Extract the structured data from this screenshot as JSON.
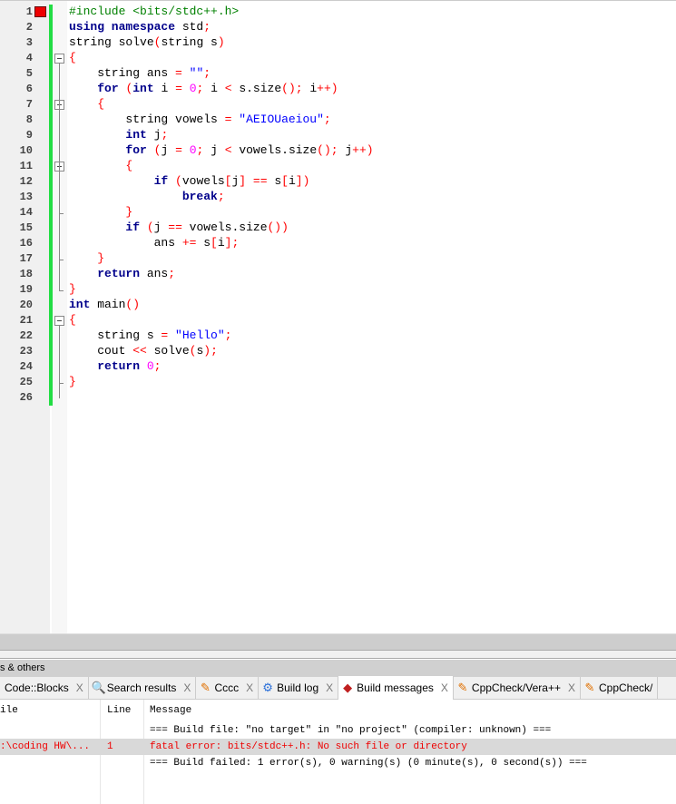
{
  "editor": {
    "lines": [
      [
        [
          "pp",
          "#include <bits/stdc++.h>"
        ]
      ],
      [
        [
          "kw",
          "using namespace"
        ],
        [
          "pl",
          " std"
        ],
        [
          "op",
          ";"
        ]
      ],
      [
        [
          "pl",
          "string solve"
        ],
        [
          "op",
          "("
        ],
        [
          "pl",
          "string s"
        ],
        [
          "op",
          ")"
        ]
      ],
      [
        [
          "op",
          "{"
        ]
      ],
      [
        [
          "pl",
          "    string ans "
        ],
        [
          "op",
          "="
        ],
        [
          "pl",
          " "
        ],
        [
          "str",
          "\"\""
        ],
        [
          "op",
          ";"
        ]
      ],
      [
        [
          "pl",
          "    "
        ],
        [
          "kw",
          "for"
        ],
        [
          "pl",
          " "
        ],
        [
          "op",
          "("
        ],
        [
          "kw",
          "int"
        ],
        [
          "pl",
          " i "
        ],
        [
          "op",
          "="
        ],
        [
          "pl",
          " "
        ],
        [
          "num",
          "0"
        ],
        [
          "op",
          ";"
        ],
        [
          "pl",
          " i "
        ],
        [
          "op",
          "<"
        ],
        [
          "pl",
          " s.size"
        ],
        [
          "op",
          "();"
        ],
        [
          "pl",
          " i"
        ],
        [
          "op",
          "++)"
        ]
      ],
      [
        [
          "pl",
          "    "
        ],
        [
          "op",
          "{"
        ]
      ],
      [
        [
          "pl",
          "        string vowels "
        ],
        [
          "op",
          "="
        ],
        [
          "pl",
          " "
        ],
        [
          "str",
          "\"AEIOUaeiou\""
        ],
        [
          "op",
          ";"
        ]
      ],
      [
        [
          "pl",
          "        "
        ],
        [
          "kw",
          "int"
        ],
        [
          "pl",
          " j"
        ],
        [
          "op",
          ";"
        ]
      ],
      [
        [
          "pl",
          "        "
        ],
        [
          "kw",
          "for"
        ],
        [
          "pl",
          " "
        ],
        [
          "op",
          "("
        ],
        [
          "pl",
          "j "
        ],
        [
          "op",
          "="
        ],
        [
          "pl",
          " "
        ],
        [
          "num",
          "0"
        ],
        [
          "op",
          ";"
        ],
        [
          "pl",
          " j "
        ],
        [
          "op",
          "<"
        ],
        [
          "pl",
          " vowels.size"
        ],
        [
          "op",
          "();"
        ],
        [
          "pl",
          " j"
        ],
        [
          "op",
          "++)"
        ]
      ],
      [
        [
          "pl",
          "        "
        ],
        [
          "op",
          "{"
        ]
      ],
      [
        [
          "pl",
          "            "
        ],
        [
          "kw",
          "if"
        ],
        [
          "pl",
          " "
        ],
        [
          "op",
          "("
        ],
        [
          "pl",
          "vowels"
        ],
        [
          "op",
          "["
        ],
        [
          "pl",
          "j"
        ],
        [
          "op",
          "]"
        ],
        [
          "pl",
          " "
        ],
        [
          "op",
          "=="
        ],
        [
          "pl",
          " s"
        ],
        [
          "op",
          "["
        ],
        [
          "pl",
          "i"
        ],
        [
          "op",
          "])"
        ]
      ],
      [
        [
          "pl",
          "                "
        ],
        [
          "kw",
          "break"
        ],
        [
          "op",
          ";"
        ]
      ],
      [
        [
          "pl",
          "        "
        ],
        [
          "op",
          "}"
        ]
      ],
      [
        [
          "pl",
          "        "
        ],
        [
          "kw",
          "if"
        ],
        [
          "pl",
          " "
        ],
        [
          "op",
          "("
        ],
        [
          "pl",
          "j "
        ],
        [
          "op",
          "=="
        ],
        [
          "pl",
          " vowels.size"
        ],
        [
          "op",
          "())"
        ]
      ],
      [
        [
          "pl",
          "            ans "
        ],
        [
          "op",
          "+="
        ],
        [
          "pl",
          " s"
        ],
        [
          "op",
          "["
        ],
        [
          "pl",
          "i"
        ],
        [
          "op",
          "];"
        ]
      ],
      [
        [
          "pl",
          "    "
        ],
        [
          "op",
          "}"
        ]
      ],
      [
        [
          "pl",
          "    "
        ],
        [
          "kw",
          "return"
        ],
        [
          "pl",
          " ans"
        ],
        [
          "op",
          ";"
        ]
      ],
      [
        [
          "op",
          "}"
        ]
      ],
      [
        [
          "kw",
          "int"
        ],
        [
          "pl",
          " main"
        ],
        [
          "op",
          "()"
        ]
      ],
      [
        [
          "op",
          "{"
        ]
      ],
      [
        [
          "pl",
          "    string s "
        ],
        [
          "op",
          "="
        ],
        [
          "pl",
          " "
        ],
        [
          "str",
          "\"Hello\""
        ],
        [
          "op",
          ";"
        ]
      ],
      [
        [
          "pl",
          "    cout "
        ],
        [
          "op",
          "<<"
        ],
        [
          "pl",
          " solve"
        ],
        [
          "op",
          "("
        ],
        [
          "pl",
          "s"
        ],
        [
          "op",
          ");"
        ]
      ],
      [
        [
          "pl",
          "    "
        ],
        [
          "kw",
          "return"
        ],
        [
          "pl",
          " "
        ],
        [
          "num",
          "0"
        ],
        [
          "op",
          ";"
        ]
      ],
      [
        [
          "op",
          "}"
        ]
      ],
      []
    ]
  },
  "panel": {
    "title": "s & others",
    "tabs": [
      {
        "label": "Code::Blocks",
        "icon": ""
      },
      {
        "label": "Search results",
        "icon": "🔍"
      },
      {
        "label": "Cccc",
        "icon": "✎"
      },
      {
        "label": "Build log",
        "icon": "⚙"
      },
      {
        "label": "Build messages",
        "icon": "◆"
      },
      {
        "label": "CppCheck/Vera++",
        "icon": "✎"
      },
      {
        "label": "CppCheck/",
        "icon": "✎"
      }
    ],
    "close": "X",
    "columns": {
      "file": "ile",
      "line": "Line",
      "message": "Message"
    },
    "rows": [
      {
        "file": "",
        "line": "",
        "message": "=== Build file: \"no target\" in \"no project\" (compiler: unknown) ==="
      },
      {
        "file": ":\\coding HW\\...",
        "line": "1",
        "message": "fatal error: bits/stdc++.h: No such file or directory"
      },
      {
        "file": "",
        "line": "",
        "message": "=== Build failed: 1 error(s), 0 warning(s) (0 minute(s), 0 second(s)) ==="
      }
    ]
  }
}
